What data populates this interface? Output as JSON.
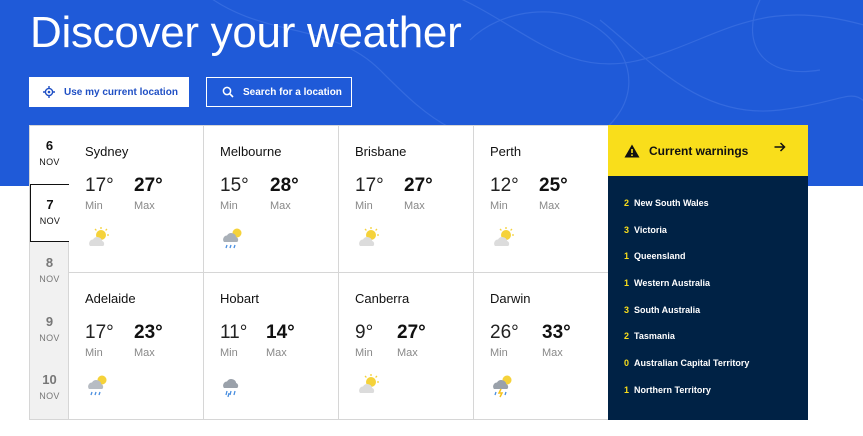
{
  "hero": {
    "title": "Discover your weather",
    "use_location_label": "Use my current location",
    "search_label": "Search for a location"
  },
  "dates": [
    {
      "day": "6",
      "month": "NOV"
    },
    {
      "day": "7",
      "month": "NOV"
    },
    {
      "day": "8",
      "month": "NOV"
    },
    {
      "day": "9",
      "month": "NOV"
    },
    {
      "day": "10",
      "month": "NOV"
    }
  ],
  "cities": [
    {
      "name": "Sydney",
      "min": "17°",
      "max": "27°",
      "min_label": "Min",
      "max_label": "Max",
      "icon": "mostly-sunny-icon"
    },
    {
      "name": "Melbourne",
      "min": "15°",
      "max": "28°",
      "min_label": "Min",
      "max_label": "Max",
      "icon": "shower-icon"
    },
    {
      "name": "Brisbane",
      "min": "17°",
      "max": "27°",
      "min_label": "Min",
      "max_label": "Max",
      "icon": "mostly-sunny-icon"
    },
    {
      "name": "Perth",
      "min": "12°",
      "max": "25°",
      "min_label": "Min",
      "max_label": "Max",
      "icon": "mostly-sunny-icon"
    },
    {
      "name": "Adelaide",
      "min": "17°",
      "max": "23°",
      "min_label": "Min",
      "max_label": "Max",
      "icon": "shower-sun-icon"
    },
    {
      "name": "Hobart",
      "min": "11°",
      "max": "14°",
      "min_label": "Min",
      "max_label": "Max",
      "icon": "rain-icon"
    },
    {
      "name": "Canberra",
      "min": "9°",
      "max": "27°",
      "min_label": "Min",
      "max_label": "Max",
      "icon": "mostly-sunny-icon"
    },
    {
      "name": "Darwin",
      "min": "26°",
      "max": "33°",
      "min_label": "Min",
      "max_label": "Max",
      "icon": "storm-icon"
    }
  ],
  "warnings": {
    "title": "Current warnings",
    "items": [
      {
        "count": "2",
        "region": "New South Wales"
      },
      {
        "count": "3",
        "region": "Victoria"
      },
      {
        "count": "1",
        "region": "Queensland"
      },
      {
        "count": "1",
        "region": "Western Australia"
      },
      {
        "count": "3",
        "region": "South Australia"
      },
      {
        "count": "2",
        "region": "Tasmania"
      },
      {
        "count": "0",
        "region": "Australian Capital Territory"
      },
      {
        "count": "1",
        "region": "Northern Territory"
      }
    ]
  },
  "colors": {
    "hero_blue": "#1f5ad8",
    "warning_yellow": "#f9de1b",
    "warning_navy": "#002245"
  }
}
